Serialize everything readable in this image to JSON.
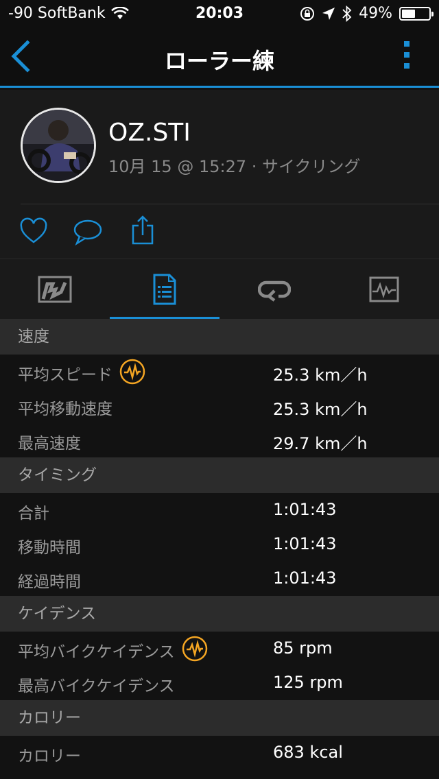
{
  "status_bar": {
    "carrier": "-90 SoftBank",
    "time": "20:03",
    "battery_text": "49%",
    "battery_level": 0.49,
    "icons": [
      "wifi-icon",
      "rotation-lock-icon",
      "location-icon",
      "bluetooth-icon",
      "battery-icon"
    ]
  },
  "nav": {
    "title": "ローラー練",
    "accent_color": "#1a8fd6"
  },
  "profile": {
    "name": "OZ.STI",
    "meta": "10月 15 @ 15:27 · サイクリング"
  },
  "actions": [
    "like-icon",
    "comment-icon",
    "share-icon"
  ],
  "tabs": [
    {
      "icon": "map-icon",
      "active": false
    },
    {
      "icon": "stats-list-icon",
      "active": true
    },
    {
      "icon": "laps-icon",
      "active": false
    },
    {
      "icon": "chart-icon",
      "active": false
    }
  ],
  "sections": [
    {
      "title": "速度",
      "rows": [
        {
          "label": "平均スピード",
          "value": "25.3 km／h",
          "badge": true
        },
        {
          "label": "平均移動速度",
          "value": "25.3 km／h",
          "badge": false
        },
        {
          "label": "最高速度",
          "value": "29.7 km／h",
          "badge": false
        }
      ]
    },
    {
      "title": "タイミング",
      "rows": [
        {
          "label": "合計",
          "value": "1:01:43",
          "badge": false
        },
        {
          "label": "移動時間",
          "value": "1:01:43",
          "badge": false
        },
        {
          "label": "経過時間",
          "value": "1:01:43",
          "badge": false
        }
      ]
    },
    {
      "title": "ケイデンス",
      "rows": [
        {
          "label": "平均バイクケイデンス",
          "value": "85 rpm",
          "badge": true
        },
        {
          "label": "最高バイクケイデンス",
          "value": "125 rpm",
          "badge": false
        }
      ]
    },
    {
      "title": "カロリー",
      "rows": [
        {
          "label": "カロリー",
          "value": "683 kcal",
          "badge": false
        }
      ]
    }
  ]
}
